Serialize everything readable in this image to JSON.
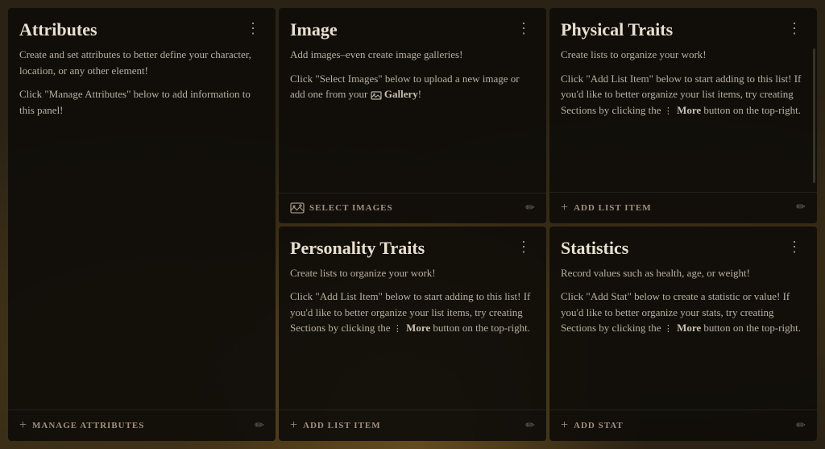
{
  "cards": {
    "attributes": {
      "title": "Attributes",
      "menu_label": "⋮",
      "body": [
        "Create and set attributes to better define your character, location, or any other element!",
        "Click \"Manage Attributes\" below to add information to this panel!"
      ],
      "footer_action": "MANAGE ATTRIBUTES"
    },
    "image": {
      "title": "Image",
      "menu_label": "⋮",
      "body": [
        "Add images–even create image galleries!",
        "Click \"Select Images\" below to upload a new image or add one from your  Gallery!"
      ],
      "footer_action": "SELECT IMAGES"
    },
    "physical_traits": {
      "title": "Physical Traits",
      "menu_label": "⋮",
      "body": [
        "Create lists to organize your work!",
        "Click \"Add List Item\" below to start adding to this list! If you'd like to better organize your list items, try creating Sections by clicking the  More button on the top-right."
      ],
      "footer_action": "ADD LIST ITEM",
      "has_scrollbar": true
    },
    "personality_traits": {
      "title": "Personality Traits",
      "menu_label": "⋮",
      "body": [
        "Create lists to organize your work!",
        "Click \"Add List Item\" below to start adding to this list! If you'd like to better organize your list items, try creating Sections by clicking the  More button on the top-right."
      ],
      "footer_action": "ADD LIST ITEM"
    },
    "statistics": {
      "title": "Statistics",
      "menu_label": "⋮",
      "body": [
        "Record values such as health, age, or weight!",
        "Click \"Add Stat\" below to create a statistic or value! If you'd like to better organize your stats, try creating Sections by clicking the  More button on the top-right."
      ],
      "footer_action": "ADD STAT"
    }
  },
  "icons": {
    "menu": "⋮",
    "plus": "+",
    "edit": "✏"
  }
}
